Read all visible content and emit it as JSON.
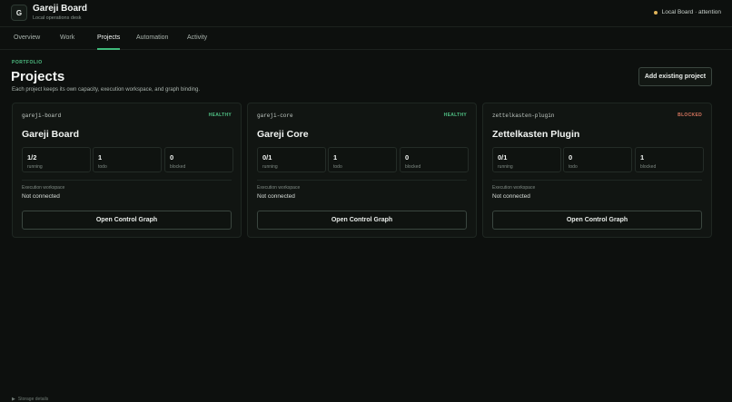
{
  "app": {
    "logo_letter": "G",
    "title": "Gareji Board",
    "subtitle": "Local operations desk",
    "status_text": "Local Board · attention",
    "status_color": "#e0b45a"
  },
  "tabs": [
    {
      "label": "Overview",
      "active": false
    },
    {
      "label": "Work",
      "active": false
    },
    {
      "label": "Projects",
      "active": true
    },
    {
      "label": "Automation",
      "active": false
    },
    {
      "label": "Activity",
      "active": false
    }
  ],
  "portfolio": {
    "eyebrow": "PORTFOLIO",
    "title": "Projects",
    "description": "Each project keeps its own capacity, execution workspace, and graph binding.",
    "add_button": "Add existing project"
  },
  "projects": [
    {
      "slug": "gareji-board",
      "health": "HEALTHY",
      "name": "Gareji Board",
      "stats": [
        {
          "value": "1/2",
          "label": "running"
        },
        {
          "value": "1",
          "label": "todo"
        },
        {
          "value": "0",
          "label": "blocked"
        }
      ],
      "workspace_label": "Execution workspace",
      "workspace_value": "Not connected",
      "button": "Open Control Graph"
    },
    {
      "slug": "gareji-core",
      "health": "HEALTHY",
      "name": "Gareji Core",
      "stats": [
        {
          "value": "0/1",
          "label": "running"
        },
        {
          "value": "1",
          "label": "todo"
        },
        {
          "value": "0",
          "label": "blocked"
        }
      ],
      "workspace_label": "Execution workspace",
      "workspace_value": "Not connected",
      "button": "Open Control Graph"
    },
    {
      "slug": "zettelkasten-plugin",
      "health": "BLOCKED",
      "name": "Zettelkasten Plugin",
      "stats": [
        {
          "value": "0/1",
          "label": "running"
        },
        {
          "value": "0",
          "label": "todo"
        },
        {
          "value": "1",
          "label": "blocked"
        }
      ],
      "workspace_label": "Execution workspace",
      "workspace_value": "Not connected",
      "button": "Open Control Graph"
    }
  ],
  "footer": {
    "storage_details": "Storage details"
  },
  "colors": {
    "accent": "#3fb97a",
    "healthy": "#4fc084",
    "blocked": "#d8765f"
  }
}
